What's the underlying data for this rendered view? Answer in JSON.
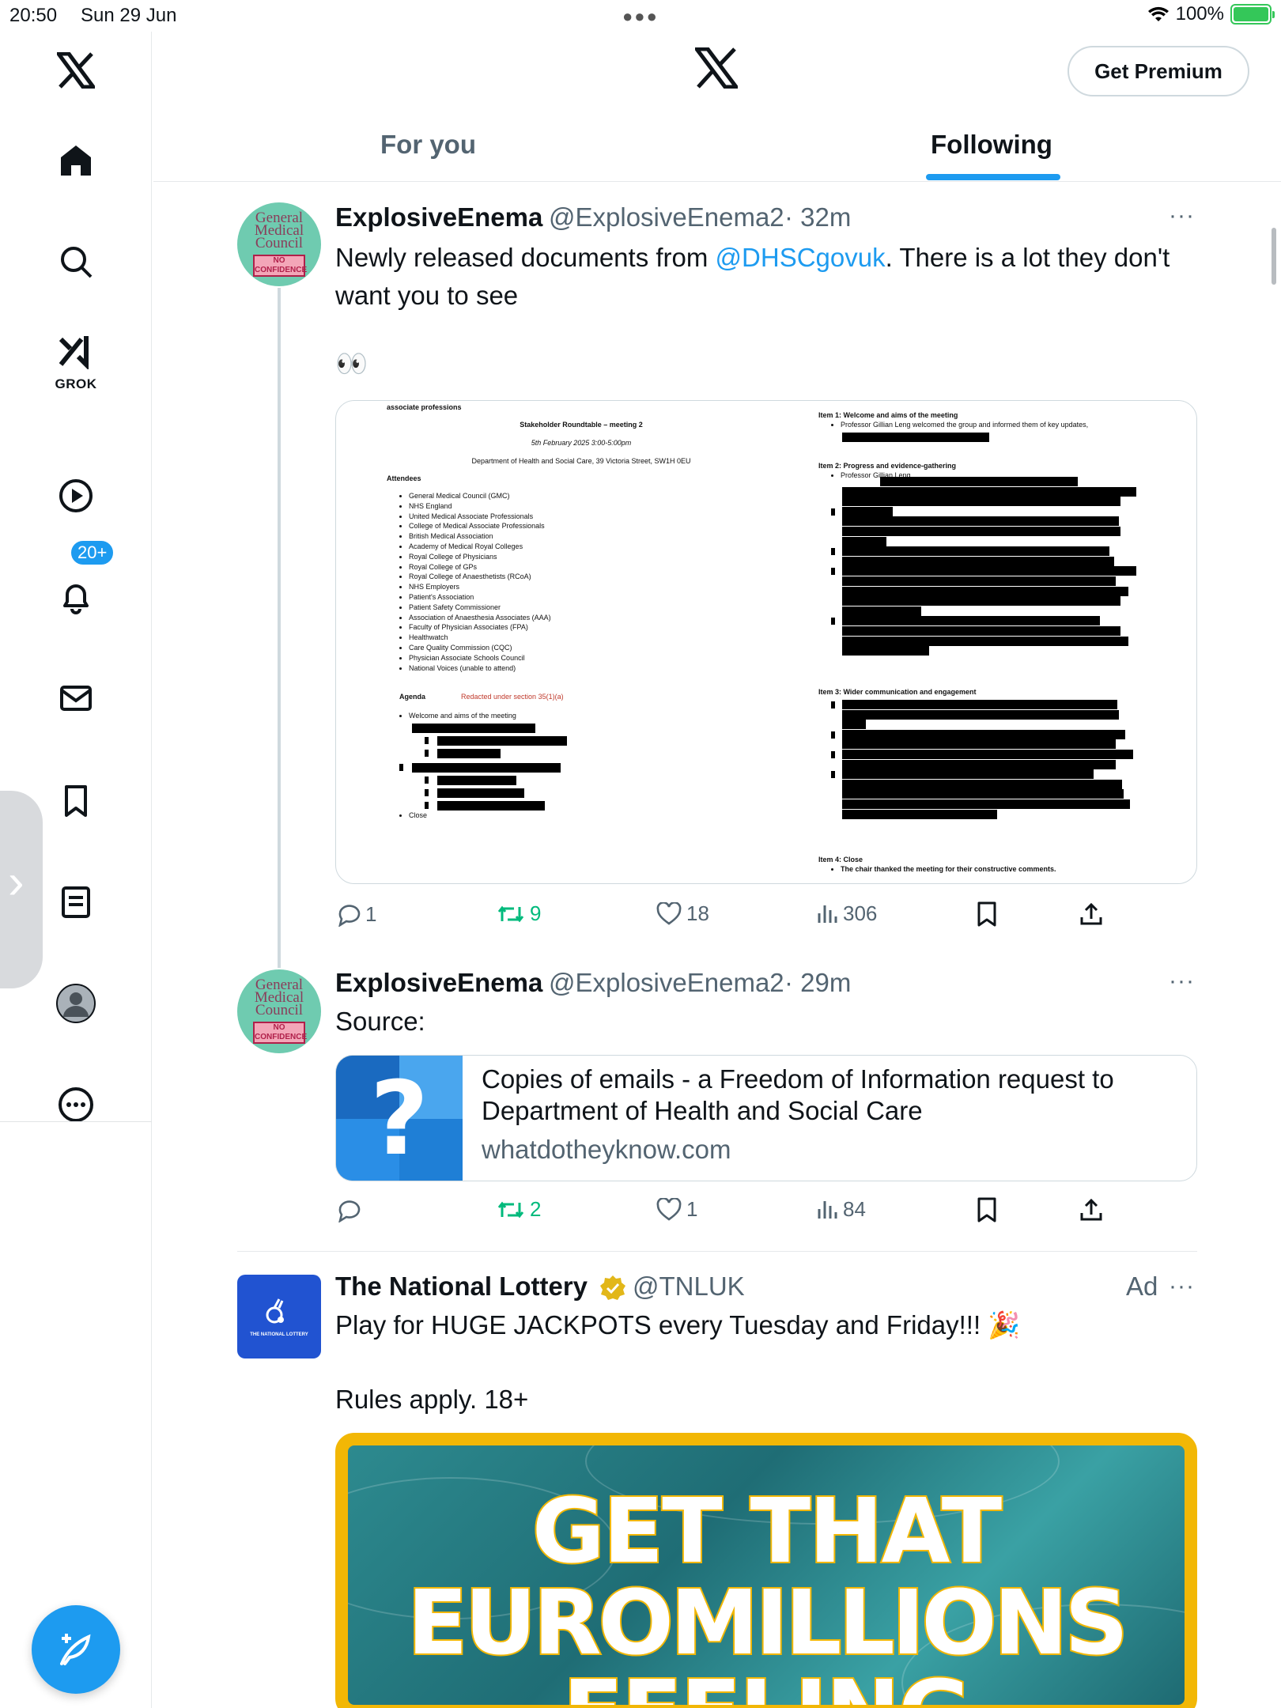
{
  "status_bar": {
    "time": "20:50",
    "date": "Sun 29 Jun",
    "battery": "100%"
  },
  "sidebar": {
    "notification_badge": "20+",
    "grok_label": "GROK",
    "items": [
      "home-icon",
      "search-icon",
      "grok-icon",
      "video-icon",
      "notifications-icon",
      "messages-icon",
      "bookmarks-icon",
      "lists-icon",
      "profile-icon",
      "more-icon"
    ]
  },
  "header": {
    "logo": "X",
    "premium_label": "Get Premium",
    "tabs": [
      {
        "label": "For you",
        "active": false
      },
      {
        "label": "Following",
        "active": true
      }
    ]
  },
  "tweets": [
    {
      "name": "ExplosiveEnema",
      "handle": "@ExplosiveEnema2",
      "time": "· 32m",
      "avatar_text": "General Medical Council",
      "avatar_stamp": "NO CONFIDENCE",
      "text_before_link": "Newly released documents from ",
      "link": "@DHSCgovuk",
      "text_after_link": ". There is a lot they don't want you to see",
      "emoji": "👀",
      "document": {
        "heading": "associate professions",
        "title": "Stakeholder Roundtable – meeting 2",
        "date": "5th February 2025 3:00-5:00pm",
        "venue": "Department of Health and Social Care, 39 Victoria Street, SW1H 0EU",
        "attendees_label": "Attendees",
        "attendees": [
          "General Medical Council (GMC)",
          "NHS England",
          "United Medical Associate Professionals",
          "College of Medical Associate Professionals",
          "British Medical Association",
          "Academy of Medical Royal Colleges",
          "Royal College of Physicians",
          "Royal College of GPs",
          "Royal College of Anaesthetists (RCoA)",
          "NHS Employers",
          "Patient's Association",
          "Patient Safety Commissioner",
          "Association of Anaesthesia Associates (AAA)",
          "Faculty of Physician Associates (FPA)",
          "Healthwatch",
          "Care Quality Commission (CQC)",
          "Physician Associate Schools Council",
          "National Voices (unable to attend)"
        ],
        "agenda_label": "Agenda",
        "redacted_note": "Redacted under section 35(1)(a)",
        "agenda_first": "Welcome and aims of the meeting",
        "agenda_last": "Close",
        "item1": "Item 1: Welcome and aims of the meeting",
        "item1_text": "Professor Gillian Leng welcomed the group and informed them of key updates,",
        "item2": "Item 2: Progress and evidence-gathering",
        "item2_text": "Professor Gillian Leng",
        "item3": "Item 3: Wider communication and engagement",
        "item4": "Item 4: Close",
        "item4_text": "The chair thanked the meeting for their constructive comments."
      },
      "stats": {
        "replies": "1",
        "reposts": "9",
        "likes": "18",
        "views": "306"
      }
    },
    {
      "name": "ExplosiveEnema",
      "handle": "@ExplosiveEnema2",
      "time": "· 29m",
      "avatar_text": "General Medical Council",
      "avatar_stamp": "NO CONFIDENCE",
      "text": "Source:",
      "card": {
        "title": "Copies of emails - a Freedom of Information request to Department of Health and Social Care",
        "domain": "whatdotheyknow.com"
      },
      "stats": {
        "replies": "",
        "reposts": "2",
        "likes": "1",
        "views": "84"
      }
    }
  ],
  "ad": {
    "name": "The National Lottery",
    "handle": "@TNLUK",
    "tag": "Ad",
    "avatar_text": "THE NATIONAL LOTTERY",
    "text": "Play for HUGE JACKPOTS every Tuesday and Friday!!! 🎉",
    "text2": "Rules apply. 18+",
    "banner_lines": [
      "GET THAT",
      "EUROMILLIONS",
      "FEELING"
    ]
  },
  "colors": {
    "accent": "#1d9bf0",
    "repost_green": "#00ba7c",
    "muted": "#536471",
    "ad_border": "#f2b705"
  }
}
